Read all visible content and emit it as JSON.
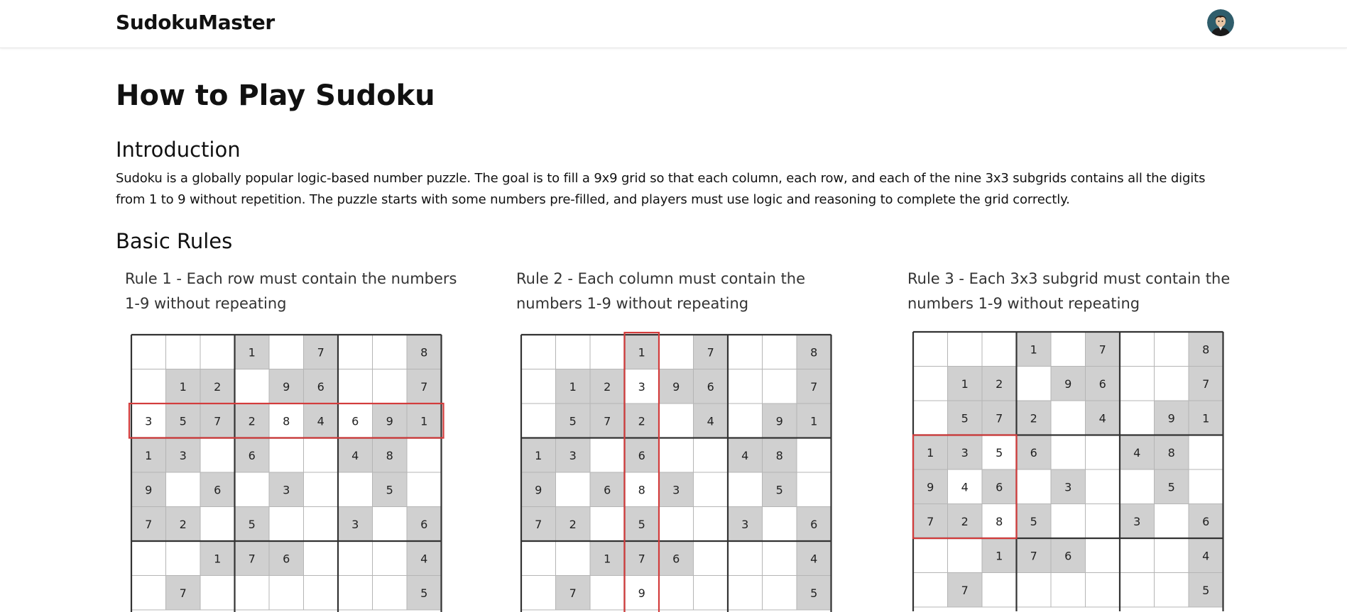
{
  "header": {
    "brand": "SudokuMaster",
    "avatar_icon": "user-avatar-icon"
  },
  "page": {
    "title": "How to Play Sudoku",
    "intro_heading": "Introduction",
    "intro_text": "Sudoku is a globally popular logic-based number puzzle. The goal is to fill a 9x9 grid so that each column, each row, and each of the nine 3x3 subgrids contains all the digits from 1 to 9 without repetition. The puzzle starts with some numbers pre-filled, and players must use logic and reasoning to complete the grid correctly.",
    "rules_heading": "Basic Rules"
  },
  "colors": {
    "given_cell": "#d0d0d0",
    "empty_cell": "#ffffff",
    "highlight": "#d33c3c",
    "grid_thin": "#b5b5b5",
    "grid_thick": "#333333"
  },
  "rules": [
    {
      "title": "Rule 1 - Each row must contain the numbers 1-9 without repeating",
      "highlight": {
        "type": "row",
        "index": 2
      },
      "cells": [
        [
          "",
          "",
          "",
          "1",
          "",
          "7",
          "",
          "",
          "8"
        ],
        [
          "",
          "1",
          "2",
          "",
          "9",
          "6",
          "",
          "",
          "7"
        ],
        [
          "3",
          "5",
          "7",
          "2",
          "8",
          "4",
          "6",
          "9",
          "1"
        ],
        [
          "1",
          "3",
          "",
          "6",
          "",
          "",
          "4",
          "8",
          ""
        ],
        [
          "9",
          "",
          "6",
          "",
          "3",
          "",
          "",
          "5",
          ""
        ],
        [
          "7",
          "2",
          "",
          "5",
          "",
          "",
          "3",
          "",
          "6"
        ],
        [
          "",
          "",
          "1",
          "7",
          "6",
          "",
          "",
          "",
          "4"
        ],
        [
          "",
          "7",
          "",
          "",
          "",
          "",
          "",
          "",
          "5"
        ]
      ],
      "givens": [
        [
          0,
          0,
          0,
          1,
          0,
          1,
          0,
          0,
          1
        ],
        [
          0,
          1,
          1,
          0,
          1,
          1,
          0,
          0,
          1
        ],
        [
          0,
          1,
          1,
          1,
          0,
          1,
          0,
          1,
          1
        ],
        [
          1,
          1,
          0,
          1,
          0,
          0,
          1,
          1,
          0
        ],
        [
          1,
          0,
          1,
          0,
          1,
          0,
          0,
          1,
          0
        ],
        [
          1,
          1,
          0,
          1,
          0,
          0,
          1,
          0,
          1
        ],
        [
          0,
          0,
          1,
          1,
          1,
          0,
          0,
          0,
          1
        ],
        [
          0,
          1,
          0,
          0,
          0,
          0,
          0,
          0,
          1
        ]
      ]
    },
    {
      "title": "Rule 2 - Each column must contain the numbers 1-9 without repeating",
      "highlight": {
        "type": "col",
        "index": 3
      },
      "cells": [
        [
          "",
          "",
          "",
          "1",
          "",
          "7",
          "",
          "",
          "8"
        ],
        [
          "",
          "1",
          "2",
          "3",
          "9",
          "6",
          "",
          "",
          "7"
        ],
        [
          "",
          "5",
          "7",
          "2",
          "",
          "4",
          "",
          "9",
          "1"
        ],
        [
          "1",
          "3",
          "",
          "6",
          "",
          "",
          "4",
          "8",
          ""
        ],
        [
          "9",
          "",
          "6",
          "8",
          "3",
          "",
          "",
          "5",
          ""
        ],
        [
          "7",
          "2",
          "",
          "5",
          "",
          "",
          "3",
          "",
          "6"
        ],
        [
          "",
          "",
          "1",
          "7",
          "6",
          "",
          "",
          "",
          "4"
        ],
        [
          "",
          "7",
          "",
          "9",
          "",
          "",
          "",
          "",
          "5"
        ]
      ],
      "givens": [
        [
          0,
          0,
          0,
          1,
          0,
          1,
          0,
          0,
          1
        ],
        [
          0,
          1,
          1,
          0,
          1,
          1,
          0,
          0,
          1
        ],
        [
          0,
          1,
          1,
          1,
          0,
          1,
          0,
          1,
          1
        ],
        [
          1,
          1,
          0,
          1,
          0,
          0,
          1,
          1,
          0
        ],
        [
          1,
          0,
          1,
          0,
          1,
          0,
          0,
          1,
          0
        ],
        [
          1,
          1,
          0,
          1,
          0,
          0,
          1,
          0,
          1
        ],
        [
          0,
          0,
          1,
          1,
          1,
          0,
          0,
          0,
          1
        ],
        [
          0,
          1,
          0,
          0,
          0,
          0,
          0,
          0,
          1
        ]
      ]
    },
    {
      "title": "Rule 3 - Each 3x3 subgrid must contain the numbers 1-9 without repeating",
      "highlight": {
        "type": "box",
        "index": 3
      },
      "cells": [
        [
          "",
          "",
          "",
          "1",
          "",
          "7",
          "",
          "",
          "8"
        ],
        [
          "",
          "1",
          "2",
          "",
          "9",
          "6",
          "",
          "",
          "7"
        ],
        [
          "",
          "5",
          "7",
          "2",
          "",
          "4",
          "",
          "9",
          "1"
        ],
        [
          "1",
          "3",
          "5",
          "6",
          "",
          "",
          "4",
          "8",
          ""
        ],
        [
          "9",
          "4",
          "6",
          "",
          "3",
          "",
          "",
          "5",
          ""
        ],
        [
          "7",
          "2",
          "8",
          "5",
          "",
          "",
          "3",
          "",
          "6"
        ],
        [
          "",
          "",
          "1",
          "7",
          "6",
          "",
          "",
          "",
          "4"
        ],
        [
          "",
          "7",
          "",
          "",
          "",
          "",
          "",
          "",
          "5"
        ]
      ],
      "givens": [
        [
          0,
          0,
          0,
          1,
          0,
          1,
          0,
          0,
          1
        ],
        [
          0,
          1,
          1,
          0,
          1,
          1,
          0,
          0,
          1
        ],
        [
          0,
          1,
          1,
          1,
          0,
          1,
          0,
          1,
          1
        ],
        [
          1,
          1,
          0,
          1,
          0,
          0,
          1,
          1,
          0
        ],
        [
          1,
          0,
          1,
          0,
          1,
          0,
          0,
          1,
          0
        ],
        [
          1,
          1,
          0,
          1,
          0,
          0,
          1,
          0,
          1
        ],
        [
          0,
          0,
          1,
          1,
          1,
          0,
          0,
          0,
          1
        ],
        [
          0,
          1,
          0,
          0,
          0,
          0,
          0,
          0,
          1
        ]
      ]
    }
  ]
}
